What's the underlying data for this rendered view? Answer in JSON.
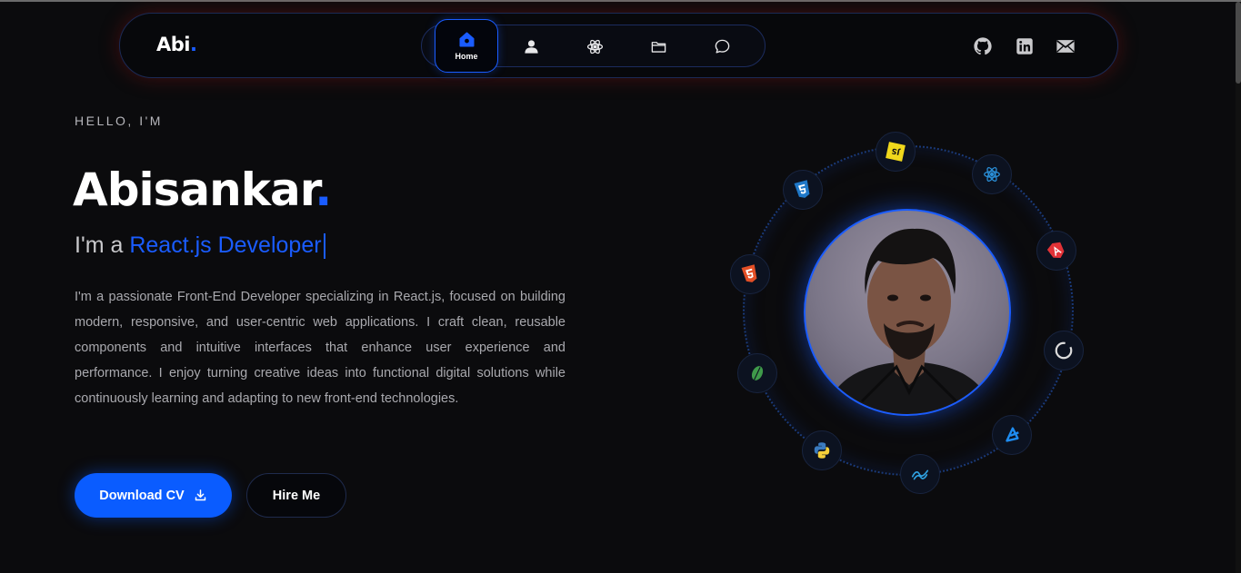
{
  "nav": {
    "logo": "Abi",
    "logo_dot": ".",
    "items": [
      {
        "icon": "home-icon",
        "label": "Home",
        "active": true
      },
      {
        "icon": "user-icon"
      },
      {
        "icon": "react-icon"
      },
      {
        "icon": "folder-icon"
      },
      {
        "icon": "chat-icon"
      }
    ],
    "social": [
      "github-icon",
      "linkedin-icon",
      "mail-icon"
    ]
  },
  "hero": {
    "greeting": "HELLO, I'M",
    "name": "Abisankar",
    "name_dot": ".",
    "role_prefix": "I'm a ",
    "role_highlight": "React.js Developer",
    "bio": "I'm a passionate Front-End Developer specializing in React.js, focused on building modern, responsive, and user-centric web applications. I craft clean, reusable components and intuitive interfaces that enhance user experience and performance. I enjoy turning creative ideas into functional digital solutions while continuously learning and adapting to new front-end technologies.",
    "download_label": "Download CV",
    "hire_label": "Hire Me"
  },
  "orbit": {
    "tech_icons": [
      "javascript-icon",
      "react-icon",
      "angular-icon",
      "nextjs-icon",
      "capacitor-icon",
      "sqlalchemy-icon",
      "python-icon",
      "mongodb-icon",
      "html5-icon",
      "css3-icon"
    ]
  },
  "colors": {
    "accent": "#1a5cff",
    "background": "#0b0b0d"
  }
}
